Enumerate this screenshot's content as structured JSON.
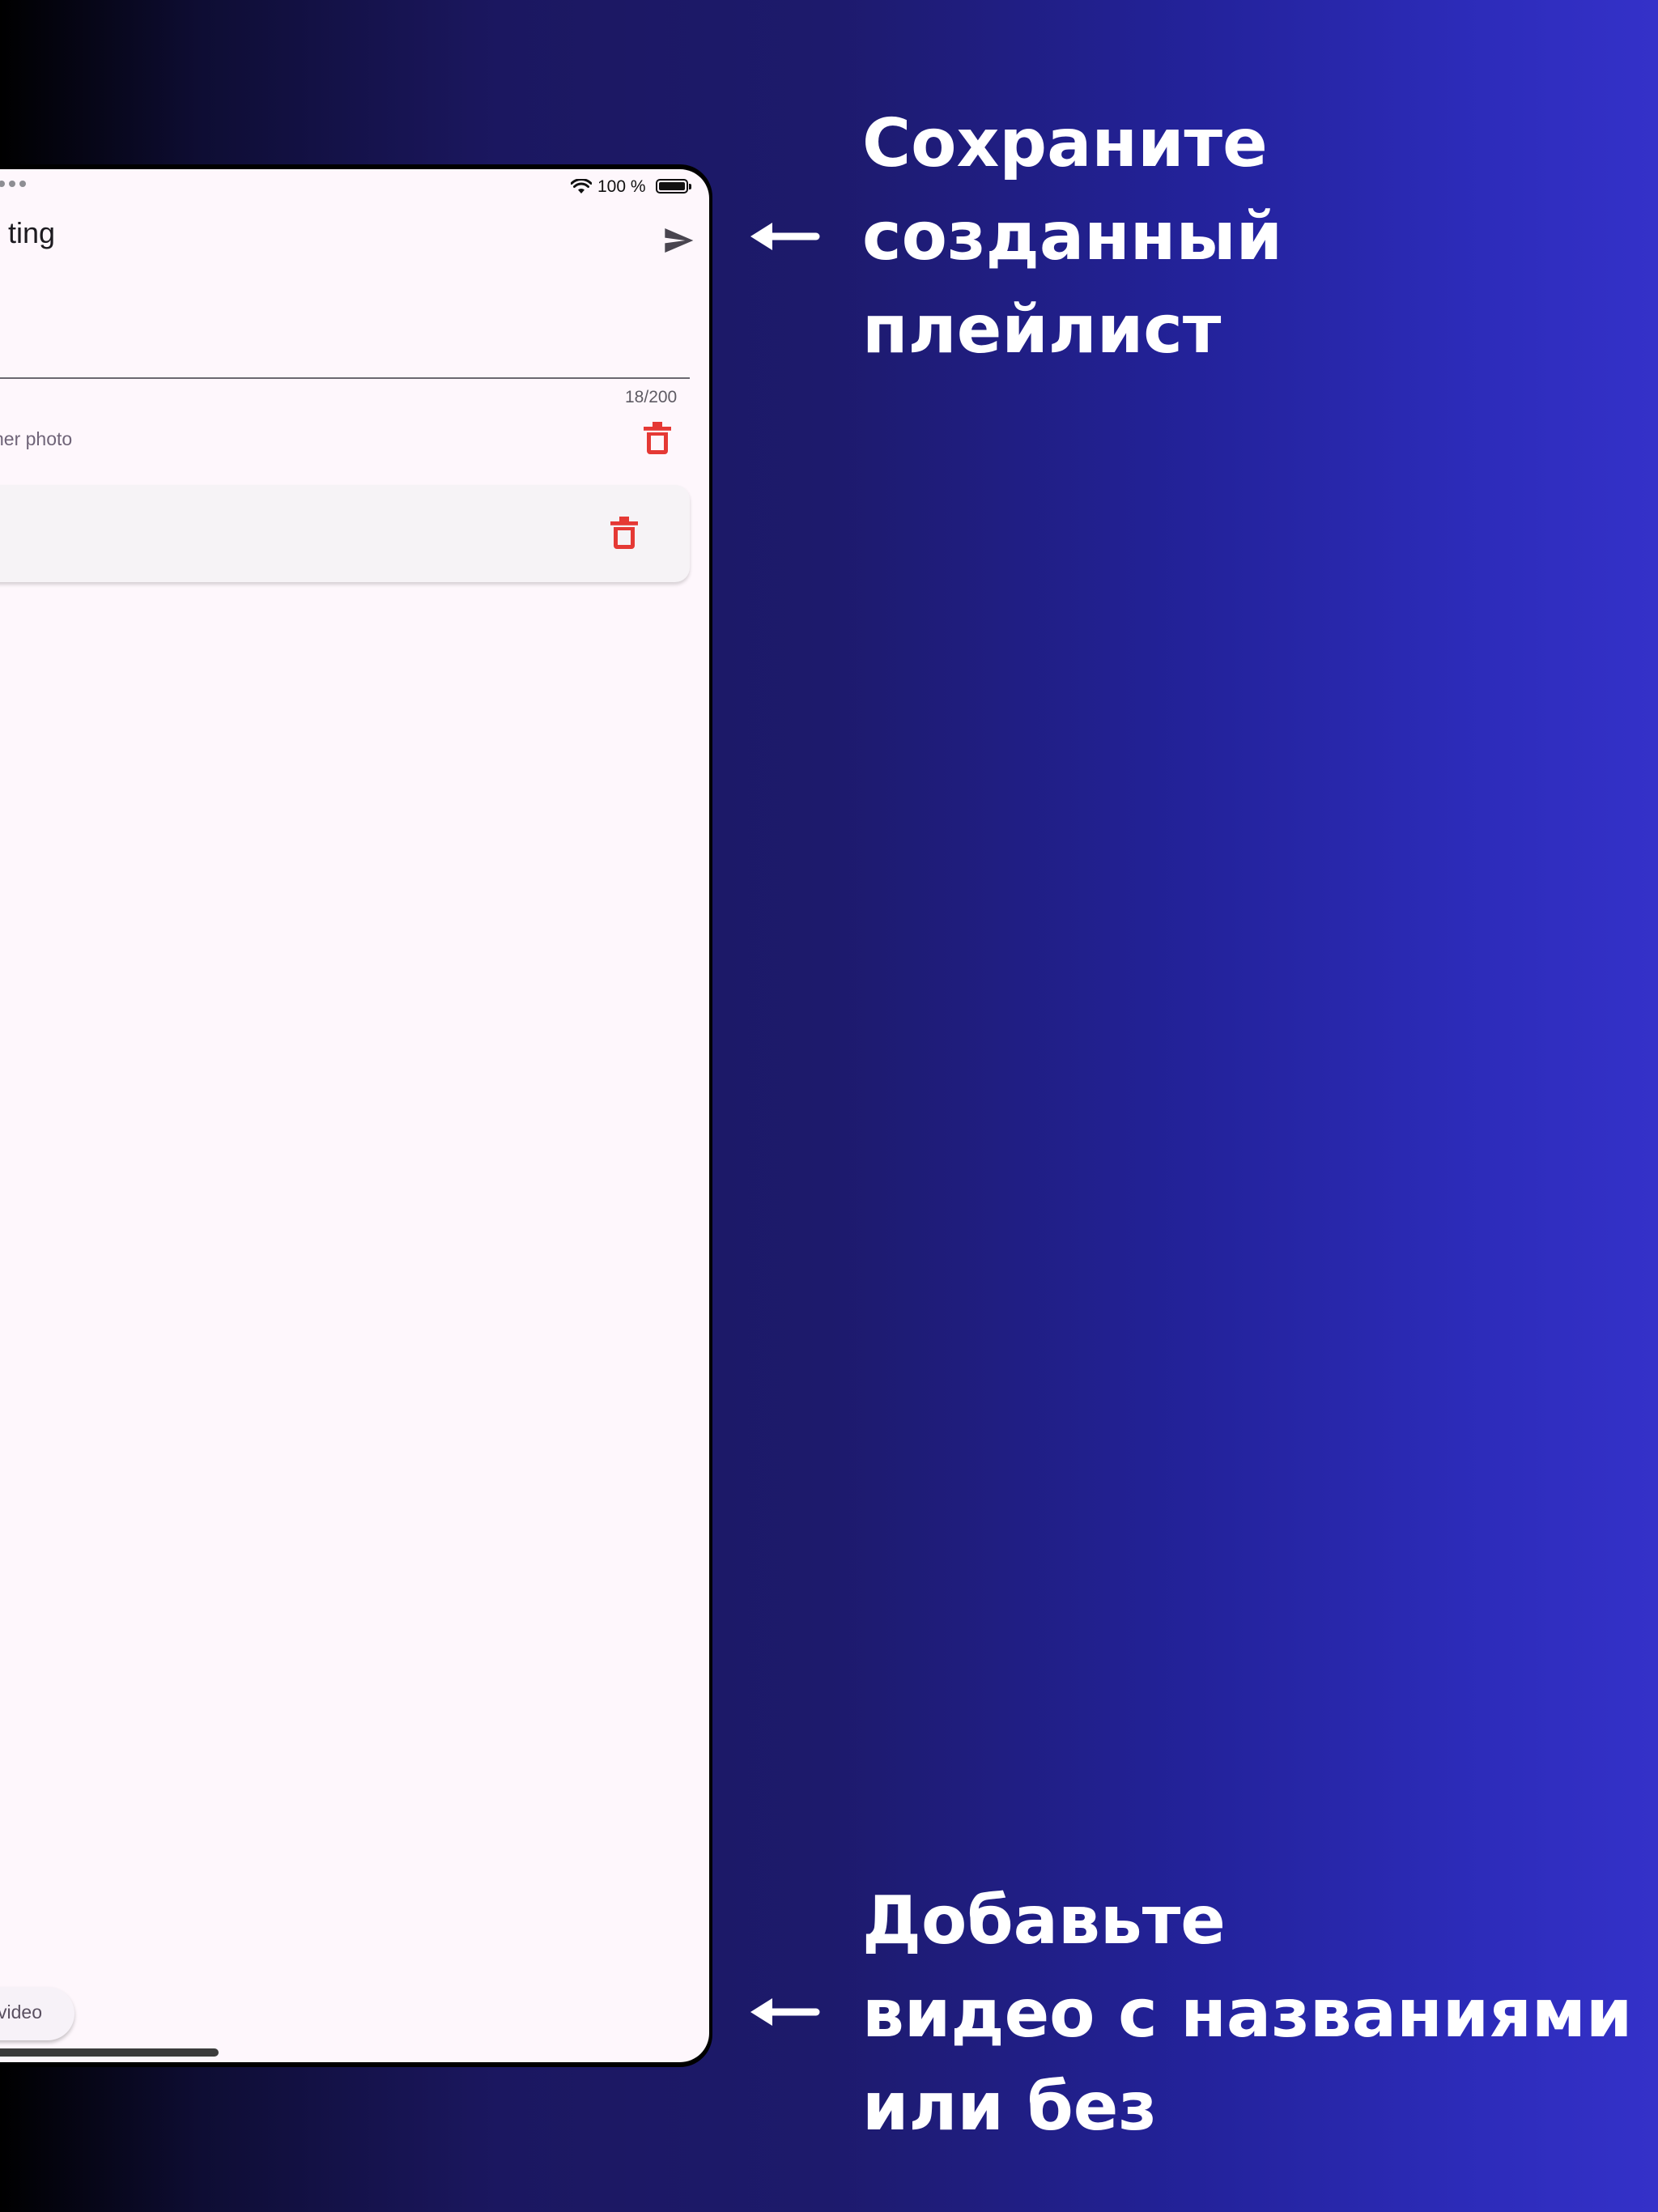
{
  "status_bar": {
    "battery_percent": "100 %"
  },
  "editor": {
    "title_fragment": "ting",
    "char_counter": "18/200",
    "photo_label": "her photo",
    "add_video_label": "video"
  },
  "annotations": {
    "top": [
      "Сохраните",
      "созданный",
      "плейлист"
    ],
    "bottom": [
      "Добавьте",
      "видео с названиями",
      "или без"
    ]
  },
  "colors": {
    "background_gradient_start": "#000000",
    "background_gradient_end": "#3431c9",
    "screen_background": "#fef7fc",
    "delete_icon": "#e53935",
    "annotation_text": "#ffffff"
  },
  "icons": {
    "send": "send-icon",
    "delete": "trash-icon",
    "wifi": "wifi-icon",
    "battery": "battery-icon",
    "arrow": "arrow-left-icon"
  }
}
